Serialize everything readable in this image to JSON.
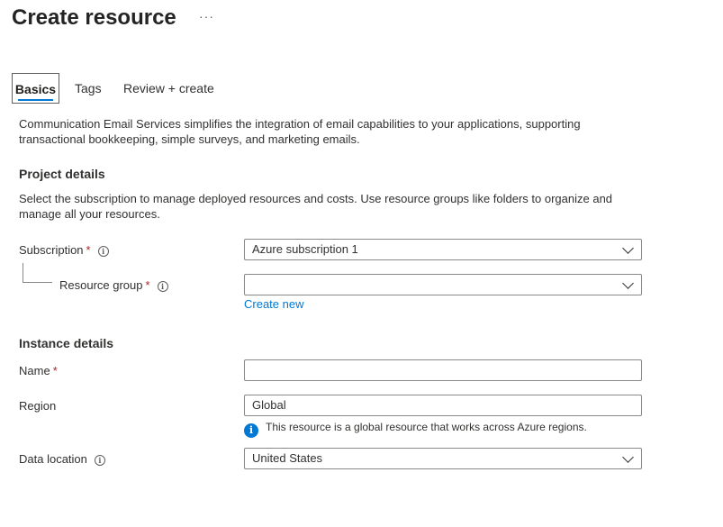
{
  "header": {
    "title": "Create resource",
    "more_label": "···"
  },
  "tabs": [
    {
      "label": "Basics",
      "active": true
    },
    {
      "label": "Tags",
      "active": false
    },
    {
      "label": "Review + create",
      "active": false
    }
  ],
  "intro": "Communication Email Services simplifies the integration of email capabilities to your applications, supporting transactional bookkeeping, simple surveys, and marketing emails.",
  "project": {
    "heading": "Project details",
    "description": "Select the subscription to manage deployed resources and costs. Use resource groups like folders to organize and manage all your resources.",
    "subscription_label": "Subscription",
    "subscription_value": "Azure subscription 1",
    "resource_group_label": "Resource group",
    "resource_group_value": "",
    "create_new": "Create new"
  },
  "instance": {
    "heading": "Instance details",
    "name_label": "Name",
    "name_value": "",
    "region_label": "Region",
    "region_value": "Global",
    "region_info": "This resource is a global resource that works across Azure regions.",
    "data_location_label": "Data location",
    "data_location_value": "United States"
  },
  "required_marker": "*",
  "info_glyph": "i",
  "colors": {
    "accent": "#0078d4",
    "required": "#a4262c",
    "text": "#323130"
  }
}
